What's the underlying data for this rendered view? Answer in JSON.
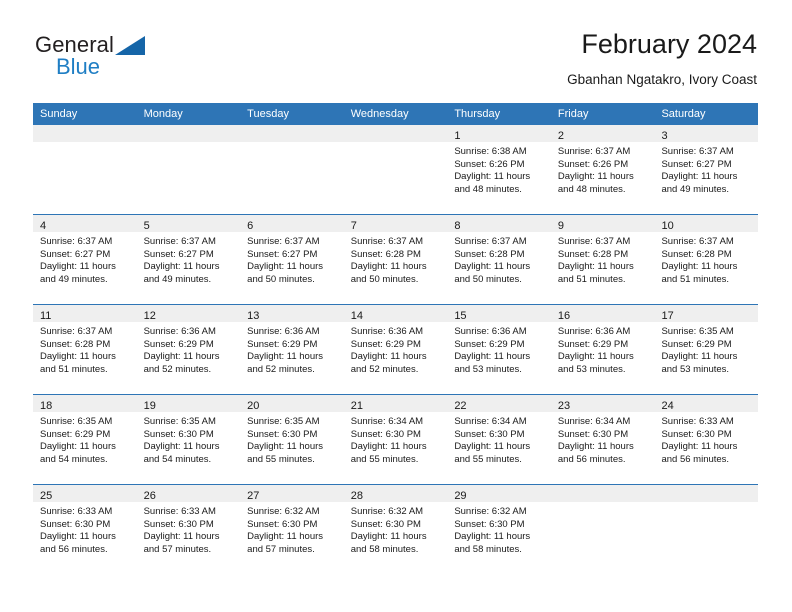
{
  "brand": {
    "name_part1": "General",
    "name_part2": "Blue",
    "triangle_icon": "triangle-icon",
    "accent_color": "#1f7ec4"
  },
  "header": {
    "title": "February 2024",
    "subtitle": "Gbanhan Ngatakro, Ivory Coast"
  },
  "colors": {
    "header_blue": "#2e75b6",
    "day_band_gray": "#efefef",
    "text": "#1a1a1a"
  },
  "weekdays": [
    "Sunday",
    "Monday",
    "Tuesday",
    "Wednesday",
    "Thursday",
    "Friday",
    "Saturday"
  ],
  "weeks": [
    [
      {
        "day": "",
        "empty": true
      },
      {
        "day": "",
        "empty": true
      },
      {
        "day": "",
        "empty": true
      },
      {
        "day": "",
        "empty": true
      },
      {
        "day": "1",
        "sunrise": "Sunrise: 6:38 AM",
        "sunset": "Sunset: 6:26 PM",
        "daylight1": "Daylight: 11 hours",
        "daylight2": "and 48 minutes."
      },
      {
        "day": "2",
        "sunrise": "Sunrise: 6:37 AM",
        "sunset": "Sunset: 6:26 PM",
        "daylight1": "Daylight: 11 hours",
        "daylight2": "and 48 minutes."
      },
      {
        "day": "3",
        "sunrise": "Sunrise: 6:37 AM",
        "sunset": "Sunset: 6:27 PM",
        "daylight1": "Daylight: 11 hours",
        "daylight2": "and 49 minutes."
      }
    ],
    [
      {
        "day": "4",
        "sunrise": "Sunrise: 6:37 AM",
        "sunset": "Sunset: 6:27 PM",
        "daylight1": "Daylight: 11 hours",
        "daylight2": "and 49 minutes."
      },
      {
        "day": "5",
        "sunrise": "Sunrise: 6:37 AM",
        "sunset": "Sunset: 6:27 PM",
        "daylight1": "Daylight: 11 hours",
        "daylight2": "and 49 minutes."
      },
      {
        "day": "6",
        "sunrise": "Sunrise: 6:37 AM",
        "sunset": "Sunset: 6:27 PM",
        "daylight1": "Daylight: 11 hours",
        "daylight2": "and 50 minutes."
      },
      {
        "day": "7",
        "sunrise": "Sunrise: 6:37 AM",
        "sunset": "Sunset: 6:28 PM",
        "daylight1": "Daylight: 11 hours",
        "daylight2": "and 50 minutes."
      },
      {
        "day": "8",
        "sunrise": "Sunrise: 6:37 AM",
        "sunset": "Sunset: 6:28 PM",
        "daylight1": "Daylight: 11 hours",
        "daylight2": "and 50 minutes."
      },
      {
        "day": "9",
        "sunrise": "Sunrise: 6:37 AM",
        "sunset": "Sunset: 6:28 PM",
        "daylight1": "Daylight: 11 hours",
        "daylight2": "and 51 minutes."
      },
      {
        "day": "10",
        "sunrise": "Sunrise: 6:37 AM",
        "sunset": "Sunset: 6:28 PM",
        "daylight1": "Daylight: 11 hours",
        "daylight2": "and 51 minutes."
      }
    ],
    [
      {
        "day": "11",
        "sunrise": "Sunrise: 6:37 AM",
        "sunset": "Sunset: 6:28 PM",
        "daylight1": "Daylight: 11 hours",
        "daylight2": "and 51 minutes."
      },
      {
        "day": "12",
        "sunrise": "Sunrise: 6:36 AM",
        "sunset": "Sunset: 6:29 PM",
        "daylight1": "Daylight: 11 hours",
        "daylight2": "and 52 minutes."
      },
      {
        "day": "13",
        "sunrise": "Sunrise: 6:36 AM",
        "sunset": "Sunset: 6:29 PM",
        "daylight1": "Daylight: 11 hours",
        "daylight2": "and 52 minutes."
      },
      {
        "day": "14",
        "sunrise": "Sunrise: 6:36 AM",
        "sunset": "Sunset: 6:29 PM",
        "daylight1": "Daylight: 11 hours",
        "daylight2": "and 52 minutes."
      },
      {
        "day": "15",
        "sunrise": "Sunrise: 6:36 AM",
        "sunset": "Sunset: 6:29 PM",
        "daylight1": "Daylight: 11 hours",
        "daylight2": "and 53 minutes."
      },
      {
        "day": "16",
        "sunrise": "Sunrise: 6:36 AM",
        "sunset": "Sunset: 6:29 PM",
        "daylight1": "Daylight: 11 hours",
        "daylight2": "and 53 minutes."
      },
      {
        "day": "17",
        "sunrise": "Sunrise: 6:35 AM",
        "sunset": "Sunset: 6:29 PM",
        "daylight1": "Daylight: 11 hours",
        "daylight2": "and 53 minutes."
      }
    ],
    [
      {
        "day": "18",
        "sunrise": "Sunrise: 6:35 AM",
        "sunset": "Sunset: 6:29 PM",
        "daylight1": "Daylight: 11 hours",
        "daylight2": "and 54 minutes."
      },
      {
        "day": "19",
        "sunrise": "Sunrise: 6:35 AM",
        "sunset": "Sunset: 6:30 PM",
        "daylight1": "Daylight: 11 hours",
        "daylight2": "and 54 minutes."
      },
      {
        "day": "20",
        "sunrise": "Sunrise: 6:35 AM",
        "sunset": "Sunset: 6:30 PM",
        "daylight1": "Daylight: 11 hours",
        "daylight2": "and 55 minutes."
      },
      {
        "day": "21",
        "sunrise": "Sunrise: 6:34 AM",
        "sunset": "Sunset: 6:30 PM",
        "daylight1": "Daylight: 11 hours",
        "daylight2": "and 55 minutes."
      },
      {
        "day": "22",
        "sunrise": "Sunrise: 6:34 AM",
        "sunset": "Sunset: 6:30 PM",
        "daylight1": "Daylight: 11 hours",
        "daylight2": "and 55 minutes."
      },
      {
        "day": "23",
        "sunrise": "Sunrise: 6:34 AM",
        "sunset": "Sunset: 6:30 PM",
        "daylight1": "Daylight: 11 hours",
        "daylight2": "and 56 minutes."
      },
      {
        "day": "24",
        "sunrise": "Sunrise: 6:33 AM",
        "sunset": "Sunset: 6:30 PM",
        "daylight1": "Daylight: 11 hours",
        "daylight2": "and 56 minutes."
      }
    ],
    [
      {
        "day": "25",
        "sunrise": "Sunrise: 6:33 AM",
        "sunset": "Sunset: 6:30 PM",
        "daylight1": "Daylight: 11 hours",
        "daylight2": "and 56 minutes."
      },
      {
        "day": "26",
        "sunrise": "Sunrise: 6:33 AM",
        "sunset": "Sunset: 6:30 PM",
        "daylight1": "Daylight: 11 hours",
        "daylight2": "and 57 minutes."
      },
      {
        "day": "27",
        "sunrise": "Sunrise: 6:32 AM",
        "sunset": "Sunset: 6:30 PM",
        "daylight1": "Daylight: 11 hours",
        "daylight2": "and 57 minutes."
      },
      {
        "day": "28",
        "sunrise": "Sunrise: 6:32 AM",
        "sunset": "Sunset: 6:30 PM",
        "daylight1": "Daylight: 11 hours",
        "daylight2": "and 58 minutes."
      },
      {
        "day": "29",
        "sunrise": "Sunrise: 6:32 AM",
        "sunset": "Sunset: 6:30 PM",
        "daylight1": "Daylight: 11 hours",
        "daylight2": "and 58 minutes."
      },
      {
        "day": "",
        "empty": true
      },
      {
        "day": "",
        "empty": true
      }
    ]
  ]
}
